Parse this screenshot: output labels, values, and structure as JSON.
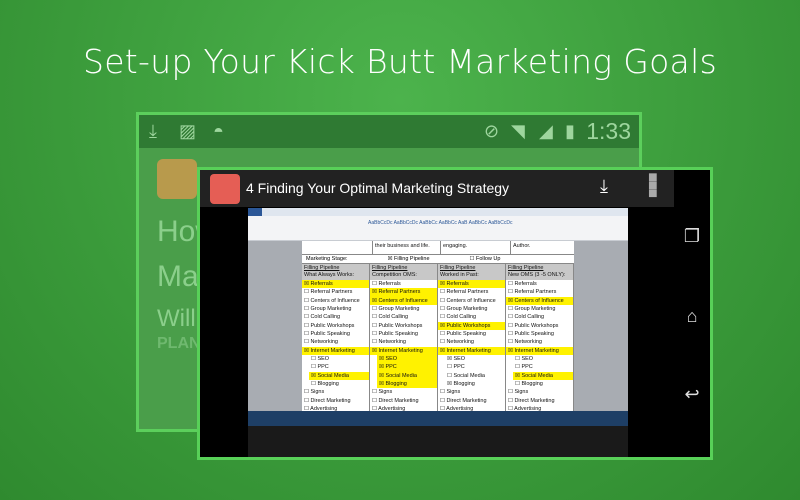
{
  "headline": "Set-up Your Kick Butt Marketing Goals",
  "back_screen": {
    "clock": "1:33",
    "text_lines": [
      "How",
      "Ma",
      "Willia",
      "PLAN"
    ]
  },
  "video": {
    "title": "4  Finding Your Optimal Marketing Strategy"
  },
  "doc": {
    "top_cells": [
      "their business and life.",
      "engaging.",
      "Author."
    ],
    "stage_label": "Marketing Stage:",
    "stage_opt1": "☒ Filling Pipeline",
    "stage_opt2": "☐ Follow Up",
    "columns": [
      {
        "h1": "Filling Pipeline",
        "h2": "What Always Works:",
        "checked": [
          "Referrals",
          "Internet Marketing",
          "Social Media"
        ],
        "hl": [
          "Referrals",
          "Internet Marketing",
          "Social Media"
        ]
      },
      {
        "h1": "Filling Pipeline",
        "h2": "Competition OMS:",
        "checked": [
          "Referral Partners",
          "Centers of Influence",
          "Internet Marketing",
          "SEO",
          "PPC",
          "Social Media",
          "Blogging"
        ],
        "hl": [
          "Referral Partners",
          "Centers of Influence",
          "Internet Marketing",
          "SEO",
          "PPC",
          "Social Media",
          "Blogging"
        ]
      },
      {
        "h1": "Filling Pipeline",
        "h2": "Worked in Past:",
        "checked": [
          "Referrals",
          "Public Workshops",
          "Internet Marketing",
          "SEO",
          "Blogging"
        ],
        "hl": [
          "Referrals",
          "Public Workshops",
          "Internet Marketing"
        ]
      },
      {
        "h1": "Filling Pipeline",
        "h2": "New OMS (3 -5 ONLY):",
        "checked": [
          "Centers of Influence",
          "Internet Marketing",
          "Social Media"
        ],
        "hl": [
          "Centers of Influence",
          "Internet Marketing",
          "Social Media"
        ]
      }
    ],
    "items": [
      "Referrals",
      "Referral Partners",
      "Centers of Influence",
      "Group Marketing",
      "Cold Calling",
      "Public Workshops",
      "Public Speaking",
      "Networking",
      "Internet Marketing",
      "SEO",
      "PPC",
      "Social Media",
      "Blogging",
      "Signs",
      "Direct Marketing",
      "Advertising"
    ],
    "sub_items": [
      "SEO",
      "PPC",
      "Social Media",
      "Blogging"
    ]
  }
}
